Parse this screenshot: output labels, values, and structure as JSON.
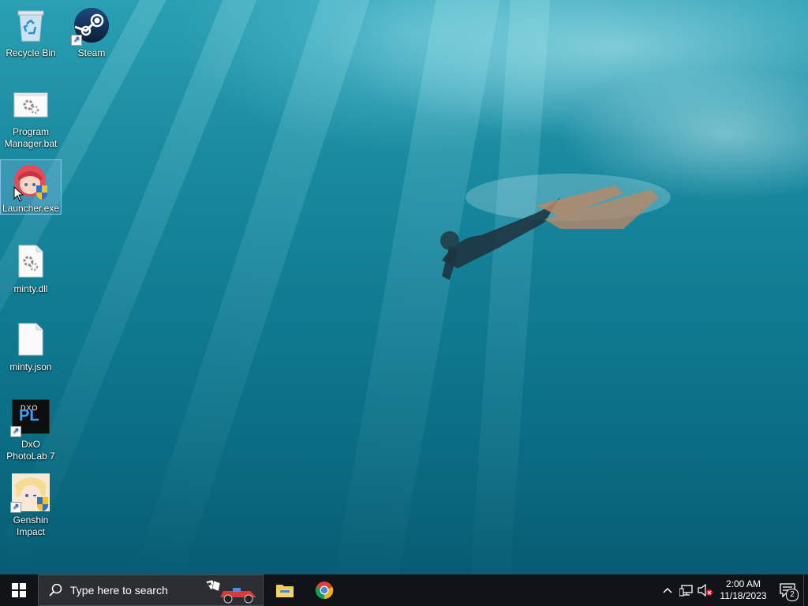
{
  "desktop": {
    "icons": [
      {
        "name": "Recycle Bin"
      },
      {
        "name": "Steam"
      },
      {
        "name": "Program Manager.bat"
      },
      {
        "name": "Launcher.exe"
      },
      {
        "name": "minty.dll"
      },
      {
        "name": "minty.json"
      },
      {
        "name": "DxO PhotoLab 7"
      },
      {
        "name": "Genshin Impact"
      }
    ],
    "dxo_badge_top": "DXO",
    "dxo_badge_main": "PL"
  },
  "taskbar": {
    "search_placeholder": "Type here to search",
    "time": "2:00 AM",
    "date": "11/18/2023",
    "notification_count": "2"
  },
  "colors": {
    "taskbar_bg": "#101418",
    "search_bg": "#2b2f33",
    "accent": "#0078d7"
  }
}
